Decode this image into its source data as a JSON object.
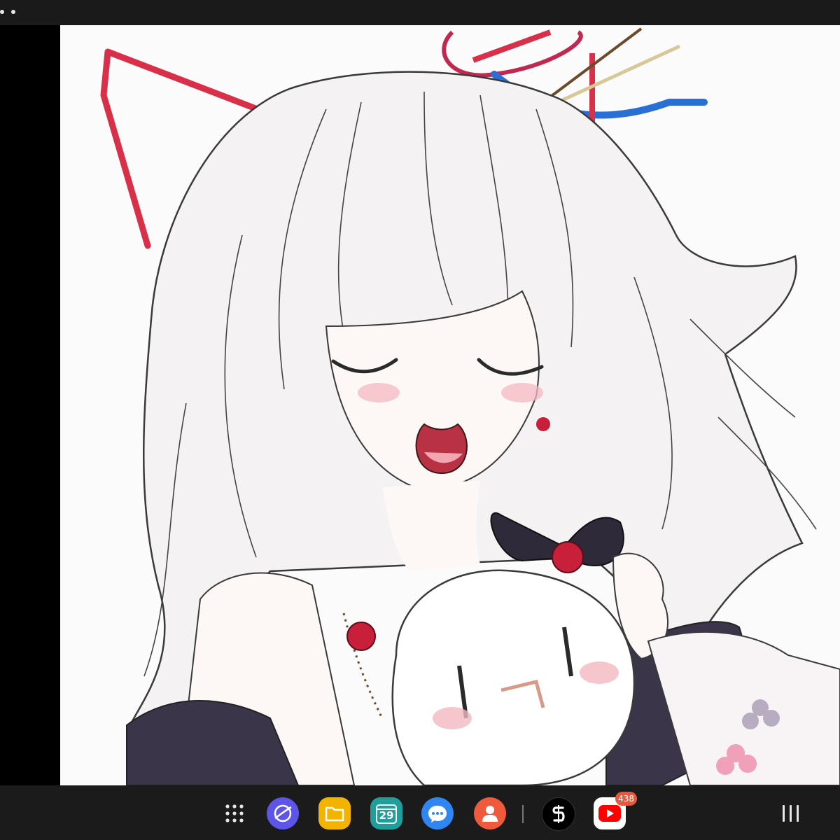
{
  "status_bar": {
    "dots": 2
  },
  "artwork": {
    "subject": "illustration",
    "palette": {
      "hair": "#f4f2f2",
      "outline": "#2b2b2b",
      "ribbon_red": "#d9304a",
      "bow": "#2e2a3a",
      "rose": "#c8203a",
      "blush": "#f2b9c0",
      "sleeve": "#3a3548"
    }
  },
  "taskbar": {
    "apps": [
      {
        "name": "apps-grid",
        "icon": "grid-icon"
      },
      {
        "name": "browser",
        "icon": "browser-icon",
        "color": "#6a5cf0"
      },
      {
        "name": "files",
        "icon": "folder-icon",
        "color": "#f2b400"
      },
      {
        "name": "calendar",
        "icon": "calendar-icon",
        "color": "#1f9e9a",
        "day": "29"
      },
      {
        "name": "messages",
        "icon": "chat-icon",
        "color": "#2f86f0"
      },
      {
        "name": "contacts",
        "icon": "contact-icon",
        "color": "#f05a3c"
      },
      {
        "name": "app-black",
        "icon": "s-icon",
        "color": "#111111"
      },
      {
        "name": "youtube",
        "icon": "youtube-icon",
        "color": "#ff0000",
        "badge": "438"
      }
    ]
  }
}
